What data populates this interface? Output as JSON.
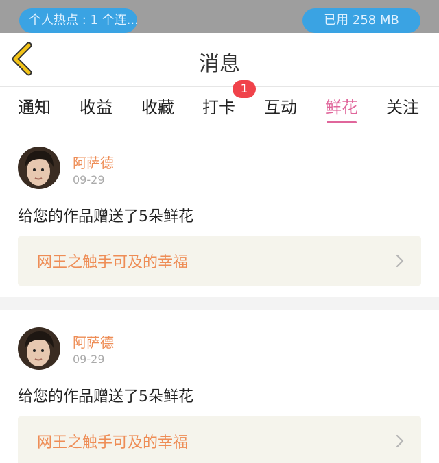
{
  "status_bar": {
    "hotspot_label": "个人热点 : 1 个连...",
    "data_used_label": "已用 258 MB"
  },
  "header": {
    "title": "消息",
    "back_icon": "chevron-left-icon",
    "accent_color": "#f2c318"
  },
  "tabs": [
    {
      "label": "通知"
    },
    {
      "label": "收益"
    },
    {
      "label": "收藏"
    },
    {
      "label": "打卡",
      "badge": "1"
    },
    {
      "label": "互动"
    },
    {
      "label": "鲜花",
      "active": true
    },
    {
      "label": "关注"
    }
  ],
  "colors": {
    "active_tab": "#e0669b",
    "name": "#ee8d56",
    "badge": "#f0424a",
    "link_bg": "#f5f4ec"
  },
  "messages": [
    {
      "user_name": "阿萨德",
      "date": "09-29",
      "text": "给您的作品赠送了5朵鲜花",
      "work_title": "网王之触手可及的幸福"
    },
    {
      "user_name": "阿萨德",
      "date": "09-29",
      "text": "给您的作品赠送了5朵鲜花",
      "work_title": "网王之触手可及的幸福"
    }
  ]
}
